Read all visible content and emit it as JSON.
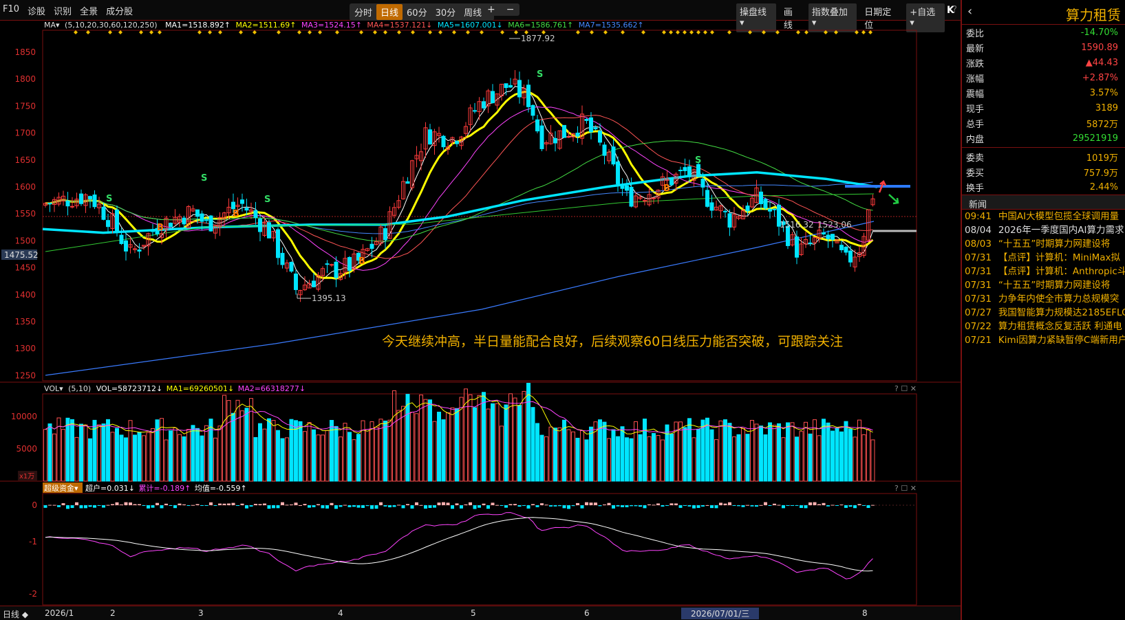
{
  "toolbar": {
    "left_items": [
      "F10",
      "诊股",
      "识别",
      "全景",
      "成分股"
    ],
    "periods": [
      "分时",
      "日线",
      "60分",
      "30分",
      "周线 ▾"
    ],
    "active_period": "日线",
    "zoom_in": "+",
    "zoom_out": "−",
    "right_items": [
      "操盘线 ▾",
      "画线",
      "指数叠加 ▾",
      "日期定位",
      "+自选 ▾"
    ],
    "help": "?",
    "collapse": "K"
  },
  "ma_legend": {
    "label": "MA▾",
    "params": "(5,10,20,30,60,120,250)",
    "items": [
      {
        "text": "MA1=1518.892↑",
        "color": "#ffffff"
      },
      {
        "text": "MA2=1511.69↑",
        "color": "#ffff00"
      },
      {
        "text": "MA3=1524.15↑",
        "color": "#ff44ff"
      },
      {
        "text": "MA4=1537.121↓",
        "color": "#ff5555"
      },
      {
        "text": "MA5=1607.001↓",
        "color": "#00e5ff"
      },
      {
        "text": "MA6=1586.761↑",
        "color": "#44dd44"
      },
      {
        "text": "MA7=1535.662↑",
        "color": "#4488ff"
      }
    ]
  },
  "price_axis": {
    "labels": [
      "1850",
      "1800",
      "1750",
      "1700",
      "1650",
      "1600",
      "1550",
      "1500",
      "1450",
      "1400",
      "1350",
      "1300",
      "1250"
    ],
    "current_marker": "1475.52"
  },
  "annotations": {
    "high": "1877.92",
    "low": "1395.13",
    "label_a": "1516.32",
    "label_b": "1523.06",
    "comment": "今天继续冲高，半日量能配合良好，后续观察60日线压力能否突破，可跟踪关注"
  },
  "vol_legend": {
    "label": "VOL▾",
    "params": "(5,10)",
    "items": [
      {
        "text": "VOL=58723712↓",
        "color": "#ffffff"
      },
      {
        "text": "MA1=69260501↓",
        "color": "#ffff00"
      },
      {
        "text": "MA2=66318277↓",
        "color": "#ff44ff"
      }
    ],
    "axis": [
      "10000",
      "5000"
    ],
    "unit": "x1万"
  },
  "fund_legend": {
    "label": "超级资金▾",
    "items": [
      {
        "text": "超户=0.031↓",
        "color": "#ffffff"
      },
      {
        "text": "累计=-0.189↑",
        "color": "#ff44ff"
      },
      {
        "text": "均值=-0.559↑",
        "color": "#ffffff"
      }
    ],
    "axis": [
      "0",
      "-1",
      "-2"
    ]
  },
  "date_axis": {
    "labels": [
      "2026/1",
      "2",
      "3",
      "4",
      "5",
      "6",
      "8"
    ],
    "highlight": "2026/07/01/三",
    "period_label": "日线 ◆"
  },
  "right_panel": {
    "title": "算力租赁",
    "quotes": [
      {
        "label": "委比",
        "value": "-14.70%",
        "color": "#33dd33"
      },
      {
        "label": "最新",
        "value": "1590.89",
        "color": "#ff4444"
      },
      {
        "label": "涨跌",
        "value": "▲44.43",
        "color": "#ff4444"
      },
      {
        "label": "涨幅",
        "value": "+2.87%",
        "color": "#ff4444"
      },
      {
        "label": "震幅",
        "value": "3.57%",
        "color": "#f0b000"
      },
      {
        "label": "现手",
        "value": "3189",
        "color": "#f0b000"
      },
      {
        "label": "总手",
        "value": "5872万",
        "color": "#f0b000"
      },
      {
        "label": "内盘",
        "value": "29521919",
        "color": "#33dd33"
      },
      {
        "label": "委卖",
        "value": "1019万",
        "color": "#f0b000"
      },
      {
        "label": "委买",
        "value": "757.9万",
        "color": "#f0b000"
      },
      {
        "label": "换手",
        "value": "2.44%",
        "color": "#f0b000"
      }
    ],
    "news_header": "新闻",
    "news": [
      {
        "date": "09:41",
        "title": "中国AI大模型包揽全球调用量"
      },
      {
        "date": "08/04",
        "title": "2026年一季度国内AI算力需求"
      },
      {
        "date": "08/03",
        "title": "“十五五”时期算力网建设将"
      },
      {
        "date": "07/31",
        "title": "【点评】计算机：MiniMax拟"
      },
      {
        "date": "07/31",
        "title": "【点评】计算机：Anthropic斗"
      },
      {
        "date": "07/31",
        "title": "“十五五”时期算力网建设将"
      },
      {
        "date": "07/31",
        "title": "力争年内使全市算力总规模突"
      },
      {
        "date": "07/27",
        "title": "我国智能算力规模达2185EFLO"
      },
      {
        "date": "07/22",
        "title": "算力租赁概念反复活跃 利通电"
      },
      {
        "date": "07/21",
        "title": "Kimi因算力紧缺暂停C端新用户"
      }
    ]
  }
}
